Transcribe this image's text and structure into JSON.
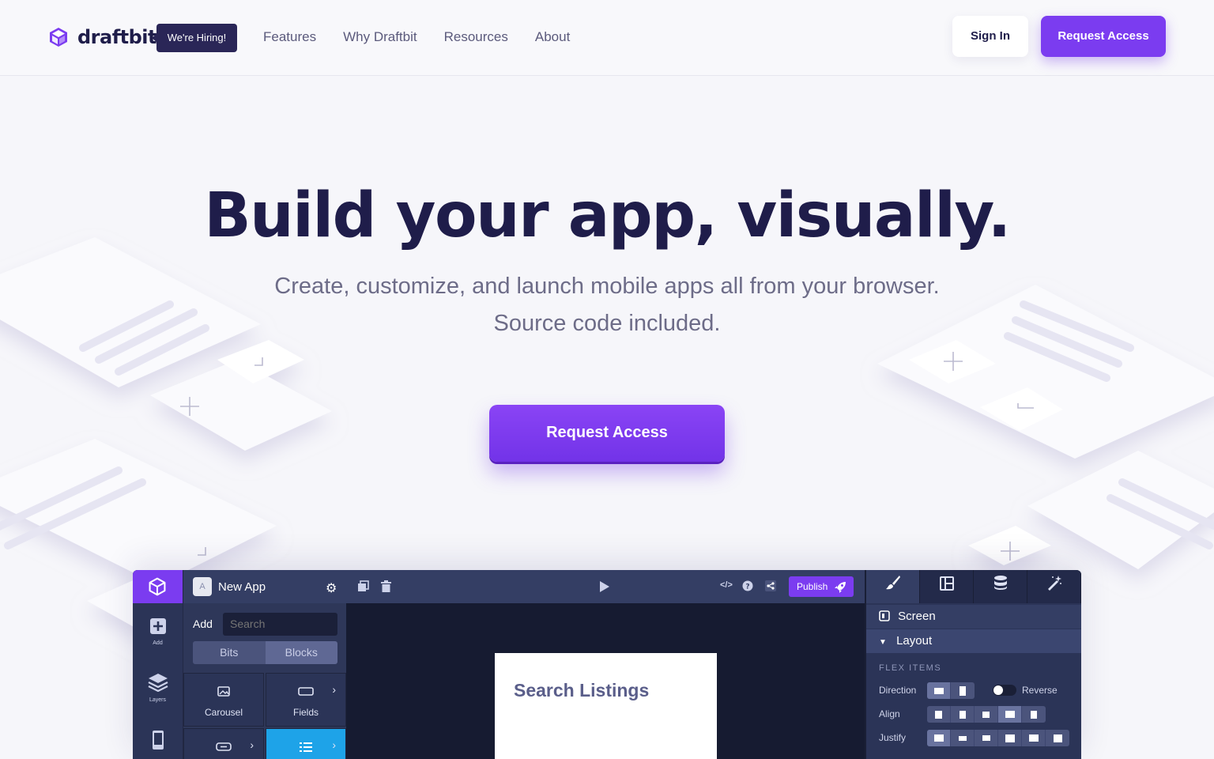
{
  "brand": {
    "name": "draftbit",
    "hiring_badge": "We're Hiring!",
    "accent": "#7b3cf0",
    "dark": "#1f1d4a"
  },
  "nav": {
    "links": [
      "Features",
      "Why Draftbit",
      "Resources",
      "About"
    ],
    "sign_in": "Sign In",
    "request_access": "Request Access"
  },
  "hero": {
    "headline": "Build your app, visually.",
    "sub_line_1": "Create, customize, and launch mobile apps all from your browser.",
    "sub_line_2": "Source code included.",
    "cta": "Request Access"
  },
  "app": {
    "rail": [
      {
        "icon": "add-square-icon",
        "label": "Add"
      },
      {
        "icon": "layers-icon",
        "label": "Layers"
      },
      {
        "icon": "phone-icon",
        "label": ""
      }
    ],
    "panel": {
      "app_badge": "A",
      "app_name": "New App",
      "add_label": "Add",
      "search_placeholder": "Search",
      "segments": [
        "Bits",
        "Blocks"
      ],
      "tiles": [
        {
          "icon": "image-icon",
          "label": "Carousel",
          "chevron": false
        },
        {
          "icon": "field-icon",
          "label": "Fields",
          "chevron": true
        },
        {
          "icon": "button-icon",
          "label": "",
          "chevron": true
        },
        {
          "icon": "list-icon",
          "label": "",
          "chevron": true,
          "active": true
        }
      ]
    },
    "toolbar": {
      "publish": "Publish"
    },
    "canvas": {
      "screen_title": "Search Listings"
    },
    "props": {
      "tabs": [
        "brush-icon",
        "layout-icon",
        "database-icon",
        "magic-wand-icon"
      ],
      "screen_label": "Screen",
      "layout_label": "Layout",
      "section": "FLEX ITEMS",
      "direction_label": "Direction",
      "reverse_label": "Reverse",
      "align_label": "Align",
      "justify_label": "Justify"
    }
  }
}
